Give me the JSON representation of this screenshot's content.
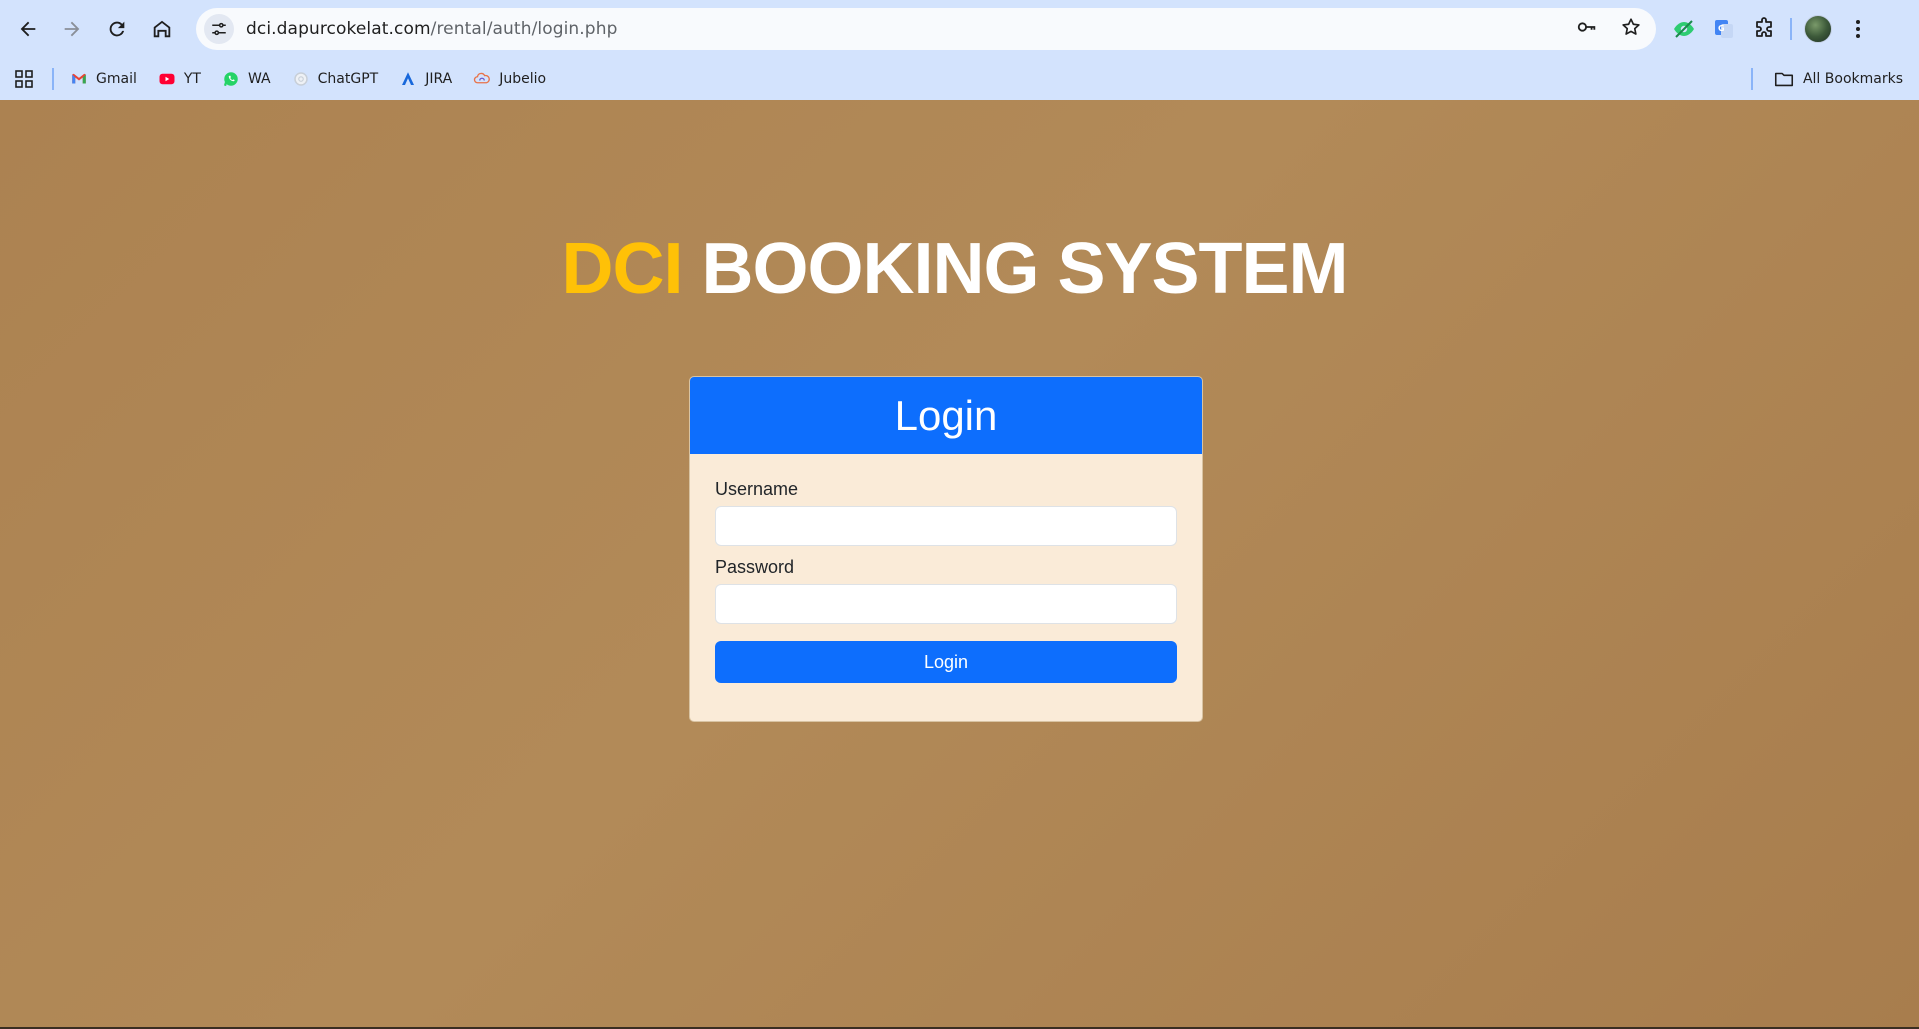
{
  "browser": {
    "url_host": "dci.dapurcokelat.com",
    "url_path": "/rental/auth/login.php",
    "nav": {
      "back_icon": "arrow-left-icon",
      "forward_icon": "arrow-right-icon",
      "reload_icon": "reload-icon",
      "home_icon": "home-icon"
    },
    "omnibox_icons": [
      "site-settings-icon",
      "password-key-icon",
      "bookmark-star-icon"
    ],
    "extensions": [
      "eye-extension-icon",
      "google-translate-icon",
      "extensions-puzzle-icon"
    ],
    "menu_icon": "kebab-menu-icon"
  },
  "bookmarks": {
    "items": [
      {
        "label": "Gmail",
        "icon": "gmail-icon"
      },
      {
        "label": "YT",
        "icon": "youtube-icon"
      },
      {
        "label": "WA",
        "icon": "whatsapp-icon"
      },
      {
        "label": "ChatGPT",
        "icon": "chatgpt-icon"
      },
      {
        "label": "JIRA",
        "icon": "jira-icon"
      },
      {
        "label": "Jubelio",
        "icon": "jubelio-icon"
      }
    ],
    "all_bookmarks_label": "All Bookmarks"
  },
  "page": {
    "title_highlight": "DCI",
    "title_rest": "BOOKING SYSTEM",
    "card": {
      "header": "Login",
      "username_label": "Username",
      "username_value": "",
      "password_label": "Password",
      "password_value": "",
      "submit_label": "Login"
    }
  },
  "colors": {
    "page_bg": "#ad8455",
    "accent_yellow": "#ffc107",
    "primary_blue": "#0d6efd",
    "card_bg": "#faebd8",
    "chrome_bg": "#d3e3fd"
  }
}
